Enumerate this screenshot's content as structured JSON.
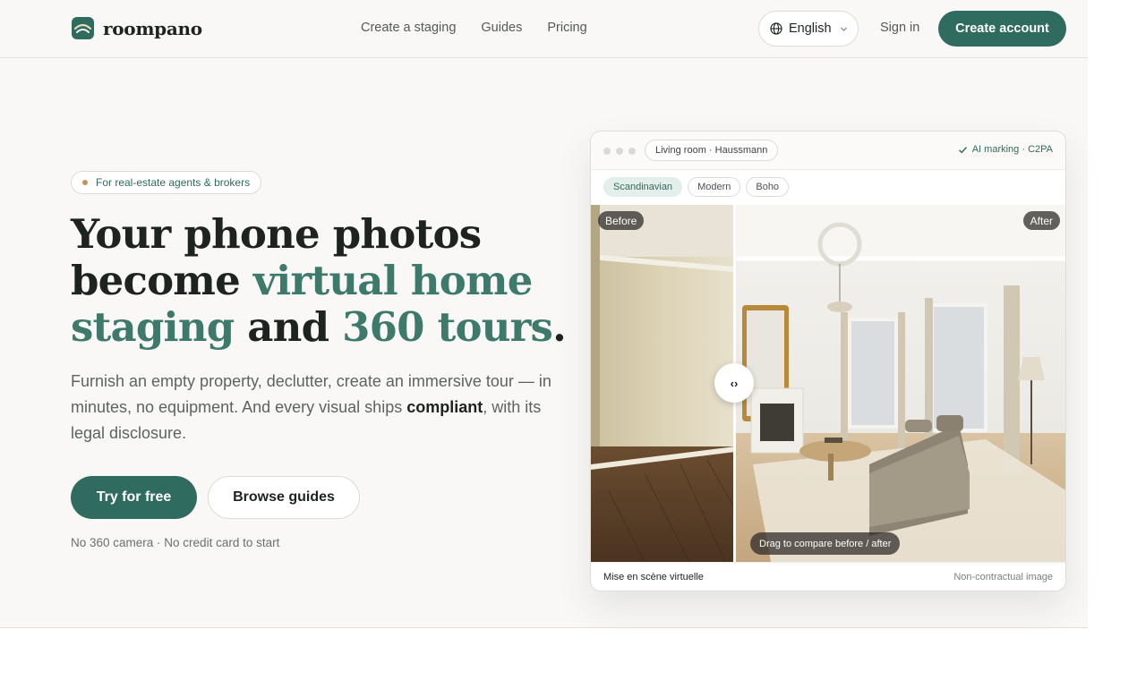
{
  "header": {
    "logo_text": "roompano",
    "nav": [
      "Create a staging",
      "Guides",
      "Pricing"
    ],
    "language": "English",
    "signin": "Sign in",
    "create_account": "Create account"
  },
  "hero": {
    "badge": "For real-estate agents & brokers",
    "headline": {
      "part1": "Your phone photos become ",
      "accent1": "virtual home staging",
      "part2": " and ",
      "accent2": "360 tours",
      "part3": "."
    },
    "subtext": {
      "before": "Furnish an empty property, declutter, create an immersive tour — in minutes, no equipment. And every visual ships ",
      "bold": "compliant",
      "after": ", with its legal disclosure."
    },
    "primary_cta": "Try for free",
    "secondary_cta": "Browse guides",
    "note": "No 360 camera · No credit card to start"
  },
  "preview": {
    "room_label": "Living room · Haussmann",
    "ai_marking": "AI marking · C2PA",
    "styles": [
      {
        "label": "Scandinavian",
        "active": true
      },
      {
        "label": "Modern",
        "active": false
      },
      {
        "label": "Boho",
        "active": false
      }
    ],
    "before_label": "Before",
    "after_label": "After",
    "handle_glyph": "‹›",
    "drag_tip": "Drag to compare before / after",
    "footer_left": "Mise en scène virtuelle",
    "footer_right": "Non-contractual image"
  },
  "colors": {
    "brand": "#2f6b5e",
    "accent_text": "#3e7a6c",
    "background": "#f9f8f6"
  }
}
